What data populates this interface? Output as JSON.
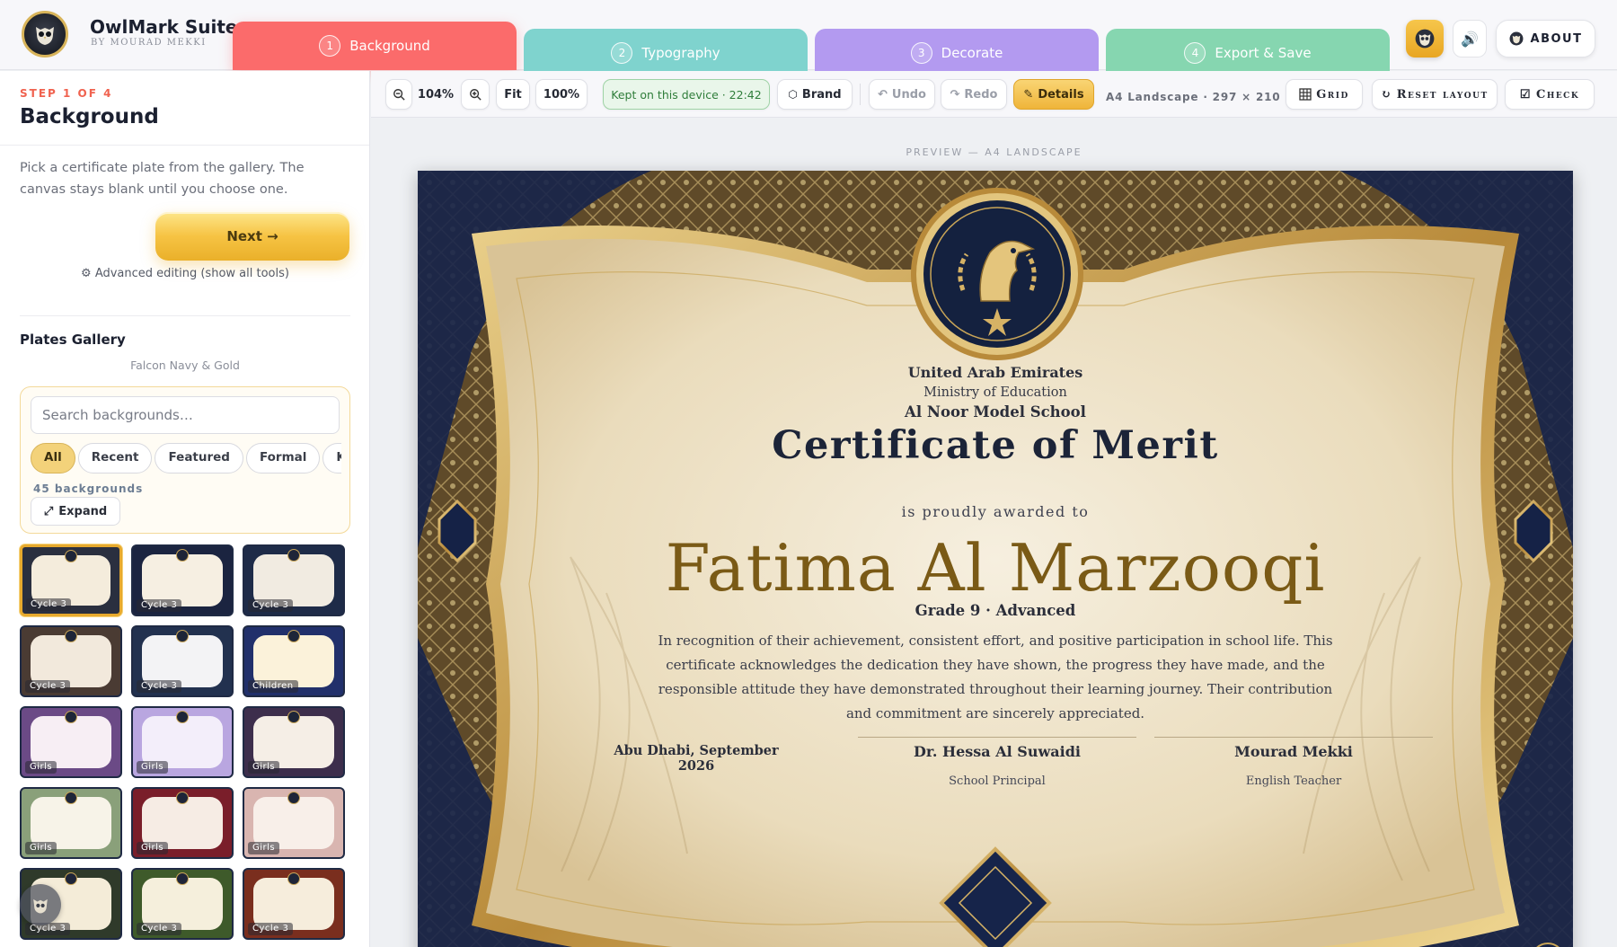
{
  "app": {
    "name": "OwlMark Suite",
    "byline": "BY MOURAD MEKKI"
  },
  "steps": [
    {
      "num": "1",
      "label": "Background",
      "color": "#fb6b6b"
    },
    {
      "num": "2",
      "label": "Typography",
      "color": "#7fd3ce"
    },
    {
      "num": "3",
      "label": "Decorate",
      "color": "#b39af0"
    },
    {
      "num": "4",
      "label": "Export & Save",
      "color": "#86d6b0"
    }
  ],
  "header": {
    "about_label": "ABOUT",
    "owl_icon": "owl-icon",
    "sound_icon": "speaker-icon"
  },
  "sidebar": {
    "step_label": "STEP 1 OF 4",
    "step_title": "Background",
    "description": "Pick a certificate plate from the gallery. The canvas stays blank until you choose one.",
    "next_label": "Next →",
    "advanced_label": "⚙ Advanced editing (show all tools)",
    "gallery_title": "Plates Gallery",
    "gallery_current": "Falcon Navy & Gold",
    "search_placeholder": "Search backgrounds…",
    "filters": [
      "All",
      "Recent",
      "Featured",
      "Formal",
      "Kids"
    ],
    "active_filter": "All",
    "count_label": "45 backgrounds",
    "expand_label": "Expand",
    "thumbnails": [
      {
        "tag": "Cycle 3",
        "frame": "#2a2f3f",
        "plate": "#f4ecdc",
        "selected": true
      },
      {
        "tag": "Cycle 3",
        "frame": "#1b2440",
        "plate": "#f6efe2",
        "selected": false
      },
      {
        "tag": "Cycle 3",
        "frame": "#1e2b48",
        "plate": "#f1ebe1",
        "selected": false
      },
      {
        "tag": "Cycle 3",
        "frame": "#4a3b33",
        "plate": "#f2e9dc",
        "selected": false
      },
      {
        "tag": "Cycle 3",
        "frame": "#22314f",
        "plate": "#f3f3f5",
        "selected": false
      },
      {
        "tag": "Children",
        "frame": "#21306b",
        "plate": "#fbf2da",
        "selected": false
      },
      {
        "tag": "Girls",
        "frame": "#6b4a86",
        "plate": "#f7eef4",
        "selected": false
      },
      {
        "tag": "Girls",
        "frame": "#b9a6e0",
        "plate": "#f3eefa",
        "selected": false
      },
      {
        "tag": "Girls",
        "frame": "#3d2e4c",
        "plate": "#f5eee6",
        "selected": false
      },
      {
        "tag": "Girls",
        "frame": "#8aa07a",
        "plate": "#f7f3e8",
        "selected": false
      },
      {
        "tag": "Girls",
        "frame": "#7a1e2a",
        "plate": "#f6ece4",
        "selected": false
      },
      {
        "tag": "Girls",
        "frame": "#d9b5b0",
        "plate": "#f8efe9",
        "selected": false
      },
      {
        "tag": "Cycle 3",
        "frame": "#2f3a2a",
        "plate": "#f4ecd8",
        "selected": false
      },
      {
        "tag": "Cycle 3",
        "frame": "#3e5a2a",
        "plate": "#f5efdc",
        "selected": false
      },
      {
        "tag": "Cycle 3",
        "frame": "#7a2e1e",
        "plate": "#f6eddc",
        "selected": false
      }
    ]
  },
  "toolbar": {
    "zoom_out_icon": "zoom-out-icon",
    "zoom_level": "104%",
    "zoom_in_icon": "zoom-in-icon",
    "fit_label": "Fit",
    "full_label": "100%",
    "saved_label": "Kept on this device · 22:42",
    "brand_label": "Brand",
    "undo_label": "Undo",
    "redo_label": "Redo",
    "details_label": "Details",
    "paper_info": "A4 Landscape · 297 × 210 mm",
    "grid_label": "Grid",
    "reset_label": "Reset layout",
    "check_label": "Check"
  },
  "canvas": {
    "preview_label": "PREVIEW — A4 LANDSCAPE"
  },
  "certificate": {
    "country": "United Arab Emirates",
    "ministry": "Ministry of Education",
    "school": "Al Noor Model School",
    "title": "Certificate of Merit",
    "awarded_to": "is proudly awarded to",
    "recipient": "Fatima Al Marzooqi",
    "grade": "Grade 9 · Advanced",
    "body": "In recognition of their achievement, consistent effort, and positive participation in school life. This certificate acknowledges the dedication they have shown, the progress they have made, and the responsible attitude they have demonstrated throughout their learning journey. Their contribution and commitment are sincerely appreciated.",
    "place_date": "Abu Dhabi, September 2026",
    "signatory1_name": "Dr. Hessa Al Suwaidi",
    "signatory1_role": "School Principal",
    "signatory2_name": "Mourad Mekki",
    "signatory2_role": "English Teacher",
    "colors": {
      "navy": "#0f1a33",
      "gold": "#c9a557",
      "parchment": "#efe3c8"
    }
  }
}
